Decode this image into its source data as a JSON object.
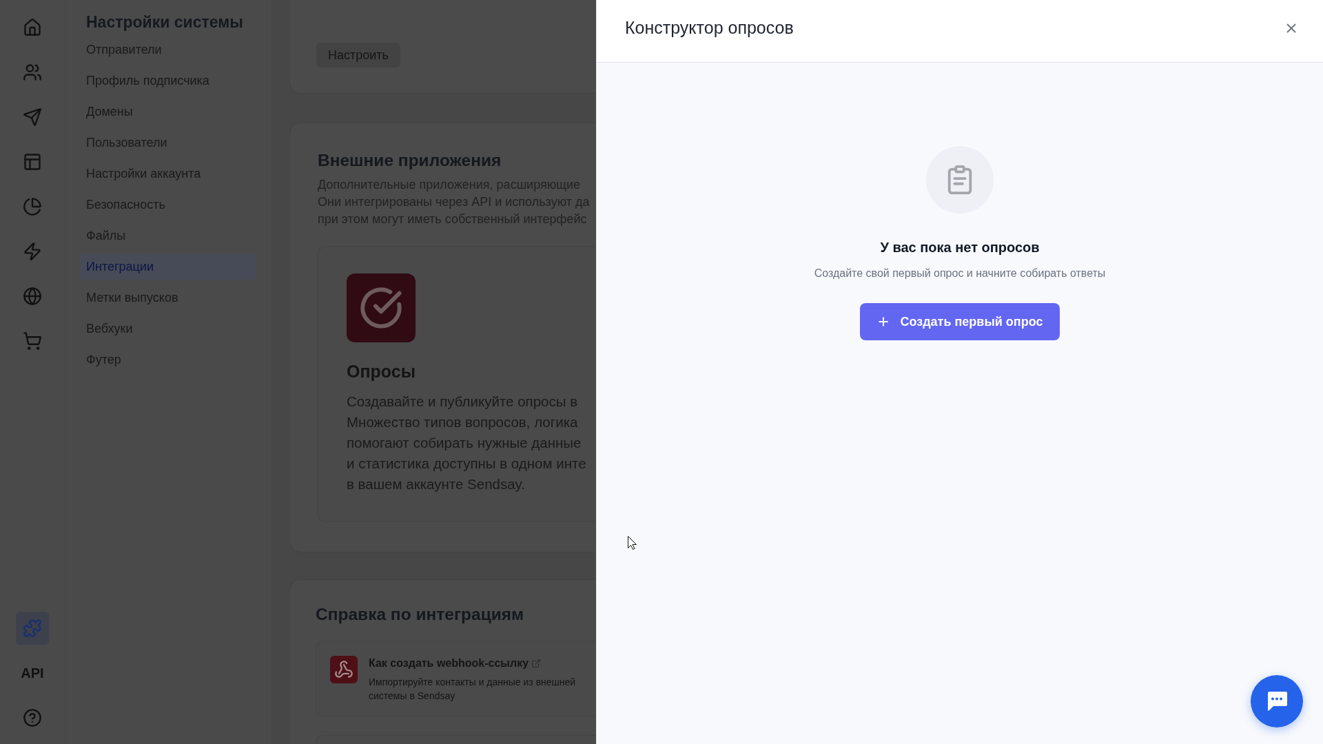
{
  "icon_rail": {
    "top_items": [
      {
        "selected": false
      },
      {
        "selected": false
      },
      {
        "selected": false
      },
      {
        "selected": false
      },
      {
        "selected": false
      },
      {
        "selected": false
      },
      {
        "selected": false
      },
      {
        "selected": false
      }
    ],
    "bottom_items": [
      {
        "kind": "icon",
        "selected": true
      },
      {
        "kind": "text",
        "label": "API",
        "selected": false
      },
      {
        "kind": "icon",
        "selected": false
      }
    ]
  },
  "settings_nav": {
    "title": "Настройки системы",
    "items": [
      {
        "label": "Отправители",
        "selected": false
      },
      {
        "label": "Профиль подписчика",
        "selected": false
      },
      {
        "label": "Домены",
        "selected": false
      },
      {
        "label": "Пользователи",
        "selected": false
      },
      {
        "label": "Настройки аккаунта",
        "selected": false
      },
      {
        "label": "Безопасность",
        "selected": false
      },
      {
        "label": "Файлы",
        "selected": false
      },
      {
        "label": "Интеграции",
        "selected": true
      },
      {
        "label": "Метки выпусков",
        "selected": false
      },
      {
        "label": "Вебхуки",
        "selected": false
      },
      {
        "label": "Футер",
        "selected": false
      }
    ]
  },
  "content": {
    "top_card": {
      "button": "Настроить"
    },
    "external_apps": {
      "title": "Внешние приложения",
      "description_lines": [
        "Дополнительные приложения, расширяющие",
        "Они интегрированы через API и используют да",
        "при этом могут иметь собственный интерфейс"
      ],
      "app_card": {
        "title": "Опросы",
        "description_lines": [
          "Создавайте и публикуйте опросы в",
          "Множество типов вопросов, логика",
          "помогают собирать нужные данные",
          "и статистика доступны в одном инте",
          "в вашем аккаунте Sendsay."
        ]
      }
    },
    "help": {
      "title": "Справка по интеграциям",
      "articles": [
        {
          "title": "Как создать webhook-ссылку",
          "external": true,
          "description": "Импортируйте контакты и данные из внешней системы в Sendsay"
        }
      ]
    }
  },
  "drawer": {
    "title": "Конструктор опросов",
    "empty_state": {
      "title": "У вас пока нет опросов",
      "text": "Создайте свой первый опрос и начните собирать ответы",
      "button": "Создать первый опрос"
    }
  }
}
